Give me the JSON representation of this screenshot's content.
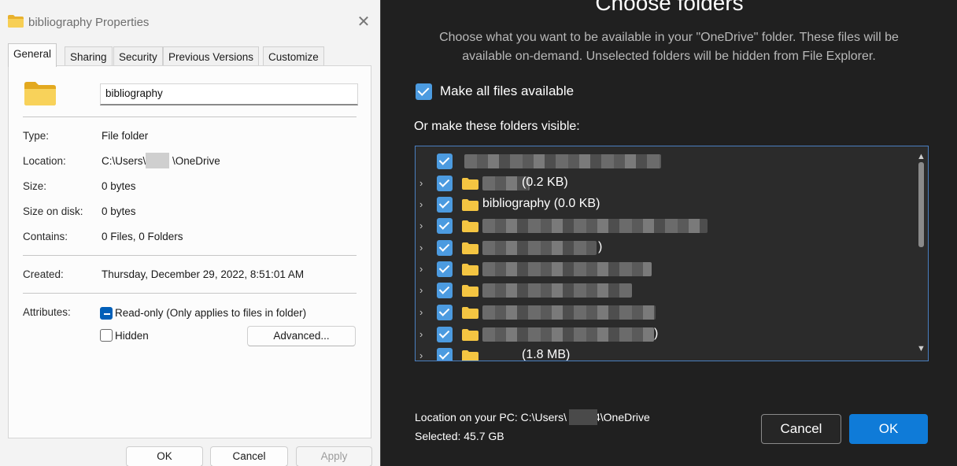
{
  "properties": {
    "title": "bibliography Properties",
    "tabs": [
      "General",
      "Sharing",
      "Security",
      "Previous Versions",
      "Customize"
    ],
    "name_value": "bibliography",
    "fields": {
      "type_label": "Type:",
      "type_value": "File folder",
      "location_label": "Location:",
      "location_value": "C:\\Users\\     \\OneDrive",
      "size_label": "Size:",
      "size_value": "0 bytes",
      "size_on_disk_label": "Size on disk:",
      "size_on_disk_value": "0 bytes",
      "contains_label": "Contains:",
      "contains_value": "0 Files, 0 Folders",
      "created_label": "Created:",
      "created_value": "Thursday, December 29, 2022, 8:51:01 AM",
      "attributes_label": "Attributes:"
    },
    "readonly_label": "Read-only (Only applies to files in folder)",
    "hidden_label": "Hidden",
    "advanced_label": "Advanced...",
    "ok_label": "OK",
    "cancel_label": "Cancel",
    "apply_label": "Apply"
  },
  "choose": {
    "heading": "Choose folders",
    "description": "Choose what you want to be available in your \"OneDrive\" folder. These files will be available on-demand. Unselected folders will be hidden from File Explorer.",
    "make_all_label": "Make all files available",
    "sub_label": "Or make these folders visible:",
    "rows": [
      {
        "text": "",
        "chevron": false
      },
      {
        "text": "(0.2 KB)",
        "chevron": true
      },
      {
        "text": "bibliography  (0.0 KB)",
        "chevron": true
      },
      {
        "text": "",
        "chevron": true
      },
      {
        "text": ")",
        "chevron": true
      },
      {
        "text": "",
        "chevron": true
      },
      {
        "text": "",
        "chevron": true
      },
      {
        "text": "",
        "chevron": true
      },
      {
        "text": ")",
        "chevron": true
      },
      {
        "text": "(1.8 MB)",
        "chevron": true
      }
    ],
    "location_text": "Location on your PC: C:\\Users\\     4\\OneDrive",
    "selected_text": "Selected: 45.7 GB",
    "cancel_label": "Cancel",
    "ok_label": "OK"
  },
  "icons": {
    "folder": "folder-icon",
    "close": "close-icon",
    "chevron": "chevron-right-icon",
    "scroll_up": "chevron-up-icon",
    "scroll_down": "chevron-down-icon"
  },
  "colors": {
    "accent_blue": "#0f7bd8",
    "checkbox_blue": "#4c9be0",
    "folder_yellow": "#f4c542",
    "dark_bg": "#202020"
  }
}
